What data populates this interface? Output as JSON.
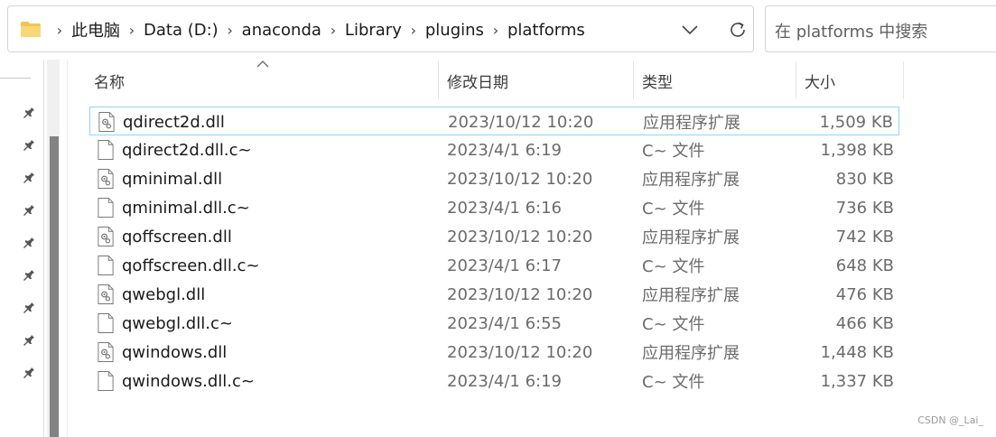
{
  "address_bar": {
    "crumbs": [
      "此电脑",
      "Data (D:)",
      "anaconda",
      "Library",
      "plugins",
      "platforms"
    ]
  },
  "search": {
    "placeholder": "在 platforms 中搜索"
  },
  "columns": {
    "name": "名称",
    "modified": "修改日期",
    "type": "类型",
    "size": "大小"
  },
  "files": [
    {
      "name": "qdirect2d.dll",
      "modified": "2023/10/12 10:20",
      "type": "应用程序扩展",
      "size": "1,509 KB",
      "icon": "dll-icon",
      "selected": true
    },
    {
      "name": "qdirect2d.dll.c~",
      "modified": "2023/4/1 6:19",
      "type": "C~ 文件",
      "size": "1,398 KB",
      "icon": "generic-file-icon",
      "selected": false
    },
    {
      "name": "qminimal.dll",
      "modified": "2023/10/12 10:20",
      "type": "应用程序扩展",
      "size": "830 KB",
      "icon": "dll-icon",
      "selected": false
    },
    {
      "name": "qminimal.dll.c~",
      "modified": "2023/4/1 6:16",
      "type": "C~ 文件",
      "size": "736 KB",
      "icon": "generic-file-icon",
      "selected": false
    },
    {
      "name": "qoffscreen.dll",
      "modified": "2023/10/12 10:20",
      "type": "应用程序扩展",
      "size": "742 KB",
      "icon": "dll-icon",
      "selected": false
    },
    {
      "name": "qoffscreen.dll.c~",
      "modified": "2023/4/1 6:17",
      "type": "C~ 文件",
      "size": "648 KB",
      "icon": "generic-file-icon",
      "selected": false
    },
    {
      "name": "qwebgl.dll",
      "modified": "2023/10/12 10:20",
      "type": "应用程序扩展",
      "size": "476 KB",
      "icon": "dll-icon",
      "selected": false
    },
    {
      "name": "qwebgl.dll.c~",
      "modified": "2023/4/1 6:55",
      "type": "C~ 文件",
      "size": "466 KB",
      "icon": "generic-file-icon",
      "selected": false
    },
    {
      "name": "qwindows.dll",
      "modified": "2023/10/12 10:20",
      "type": "应用程序扩展",
      "size": "1,448 KB",
      "icon": "dll-icon",
      "selected": false
    },
    {
      "name": "qwindows.dll.c~",
      "modified": "2023/4/1 6:19",
      "type": "C~ 文件",
      "size": "1,337 KB",
      "icon": "generic-file-icon",
      "selected": false
    }
  ],
  "nav_pins": [
    "pin-icon",
    "pin-icon",
    "pin-icon",
    "pin-icon",
    "pin-icon",
    "pin-icon",
    "pin-icon",
    "pin-icon",
    "pin-icon"
  ],
  "watermark": "CSDN @_Lai_",
  "colors": {
    "selection_border": "#99d1f2",
    "folder": "#f3c44f",
    "scroll_thumb": "#838383"
  }
}
